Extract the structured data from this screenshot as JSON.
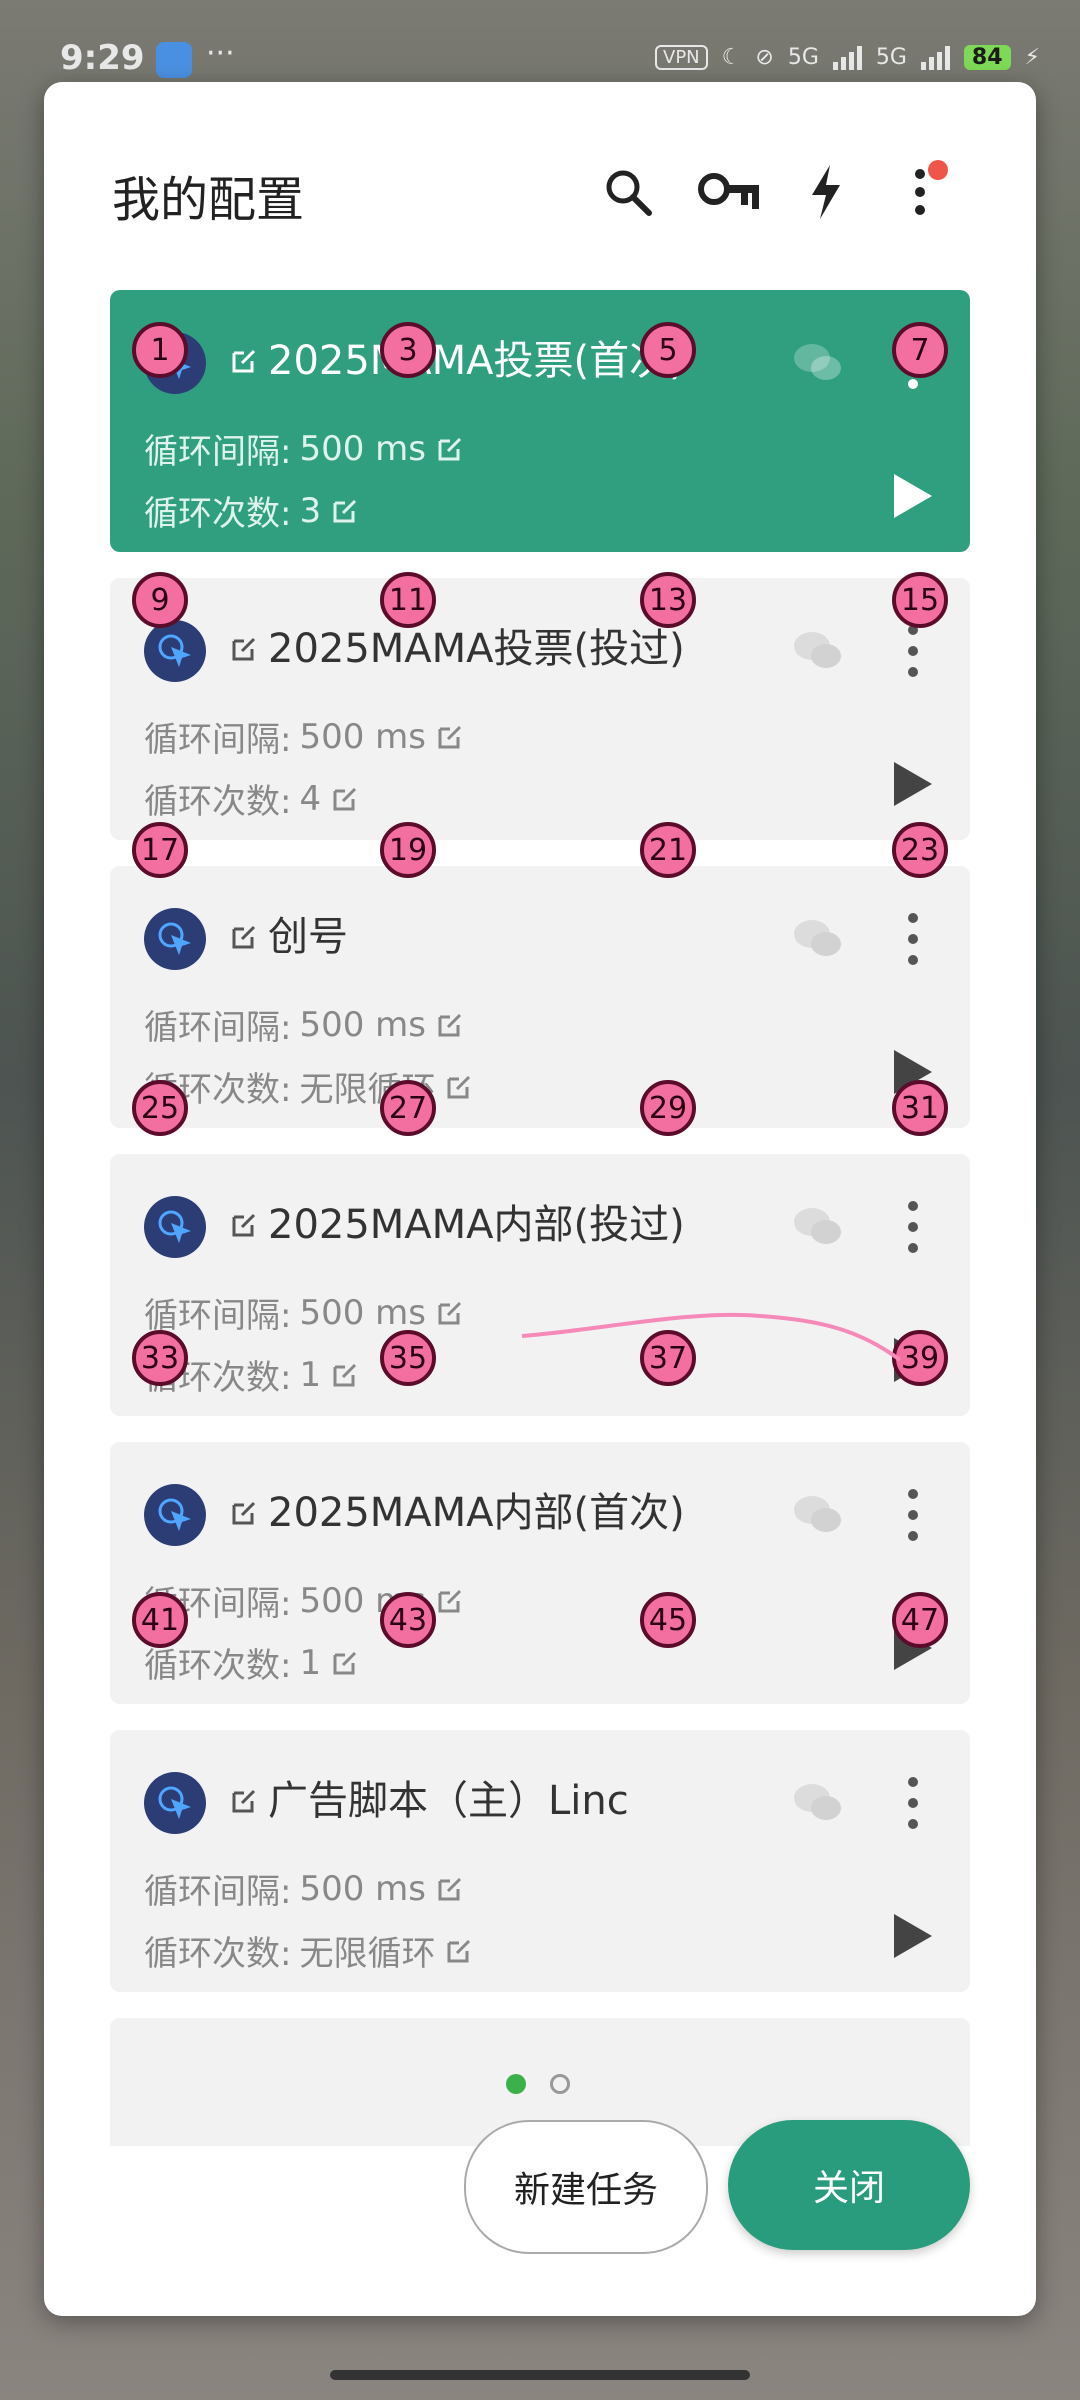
{
  "status_bar": {
    "time": "9:29",
    "dots": "···",
    "vpn": "VPN",
    "network1": "5G",
    "network2": "5G",
    "battery": "84"
  },
  "dialog": {
    "title": "我的配置",
    "icons": [
      "search-icon",
      "key-icon",
      "flash-icon",
      "more-vert-icon"
    ]
  },
  "labels": {
    "interval_prefix": "循环间隔: ",
    "count_prefix": "循环次数: "
  },
  "configs": [
    {
      "name": "2025MAMA投票(首次)",
      "interval": "500 ms",
      "count": "3",
      "active": true
    },
    {
      "name": "2025MAMA投票(投过)",
      "interval": "500 ms",
      "count": "4",
      "active": false
    },
    {
      "name": "创号",
      "interval": "500 ms",
      "count": "无限循环",
      "active": false
    },
    {
      "name": "2025MAMA内部(投过)",
      "interval": "500 ms",
      "count": "1",
      "active": false
    },
    {
      "name": "2025MAMA内部(首次)",
      "interval": "500 ms",
      "count": "1",
      "active": false
    },
    {
      "name": "广告脚本（主）Linc",
      "interval": "500 ms",
      "count": "无限循环",
      "active": false
    }
  ],
  "markers": [
    "1",
    "3",
    "5",
    "7",
    "9",
    "11",
    "13",
    "15",
    "17",
    "19",
    "21",
    "23",
    "25",
    "27",
    "29",
    "31",
    "33",
    "35",
    "37",
    "39",
    "41",
    "43",
    "45",
    "47"
  ],
  "pager": {
    "pages": 2,
    "current": 1
  },
  "buttons": {
    "new_task": "新建任务",
    "close": "关闭"
  },
  "colors": {
    "accent": "#2f9f7f",
    "marker": "#f26fa0",
    "notification": "#f0554a"
  }
}
